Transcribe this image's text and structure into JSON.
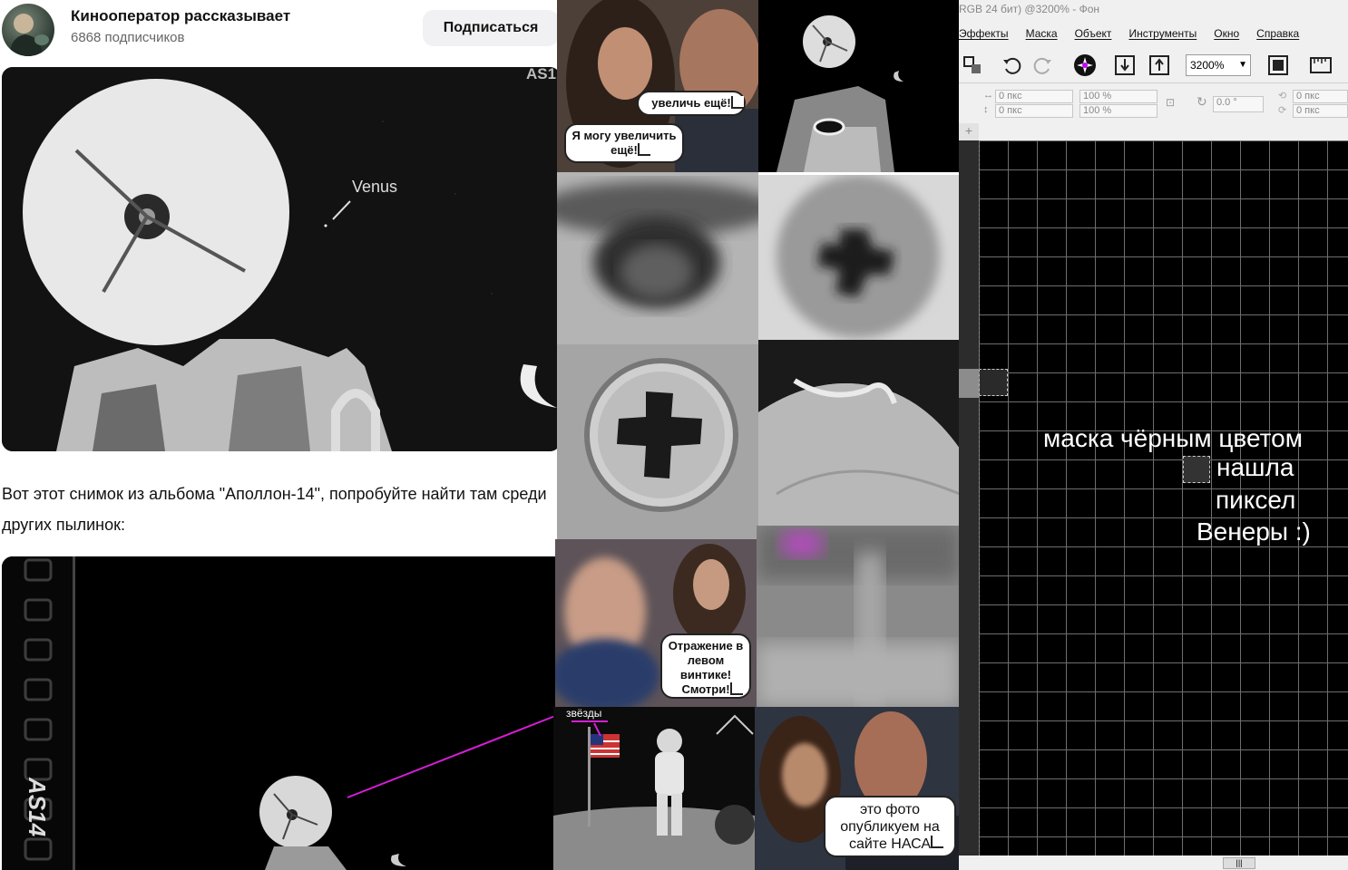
{
  "channel": {
    "name": "Кинооператор рассказывает",
    "subscribers": "6868 подписчиков",
    "subscribe_label": "Подписаться"
  },
  "article": {
    "photo1_venus_label": "Venus",
    "photo1_code": "AS1",
    "paragraph": "Вот этот снимок из альбома \"Аполлон-14\", попробуйте найти там среди других пылинок:",
    "photo2_code": "AS14"
  },
  "meme": {
    "bubble_enhance": "увеличь ещё!",
    "bubble_can_enhance": "Я могу увеличить ещё!",
    "bubble_reflection": "Отражение в левом винтике! Смотри!",
    "stars_label": "звёзды",
    "bubble_nasa": "это фото опубликуем на сайте НАСА"
  },
  "editor": {
    "title": "RGB 24 бит) @3200% - Фон",
    "menu": [
      "Эффекты",
      "Маска",
      "Объект",
      "Инструменты",
      "Окно",
      "Справка"
    ],
    "zoom": "3200%",
    "field_x": "0 пкс",
    "field_y": "0 пкс",
    "field_w": "100 %",
    "field_h": "100 %",
    "rotation": "0.0 °",
    "skew_x": "0 пкс",
    "skew_y": "0 пкс",
    "caption_line1": "маска чёрным цветом",
    "caption_line2": "нашла",
    "caption_line3": "пиксел",
    "caption_line4": "Венеры :)"
  },
  "colors": {
    "annotation_line": "#d61ed6",
    "button_bg": "#f1f1f3",
    "canvas": "#000000"
  }
}
